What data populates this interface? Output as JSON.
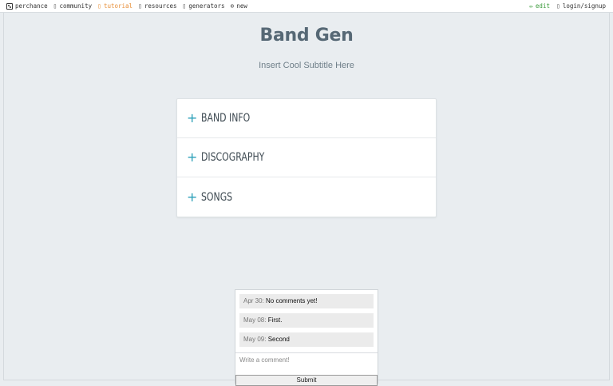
{
  "nav": {
    "left": [
      {
        "icon": "dice-icon",
        "label": "perchance"
      },
      {
        "icon": "community-icon",
        "label": "community"
      },
      {
        "icon": "tutorial-icon",
        "label": "tutorial"
      },
      {
        "icon": "resources-icon",
        "label": "resources"
      },
      {
        "icon": "generators-icon",
        "label": "generators"
      },
      {
        "icon": "new-plus-icon",
        "label": "new"
      }
    ],
    "right": [
      {
        "icon": "pencil-icon",
        "label": "edit"
      },
      {
        "icon": "user-icon",
        "label": "login/signup"
      }
    ]
  },
  "header": {
    "title": "Band Gen",
    "subtitle": "Insert Cool Subtitle Here"
  },
  "accordion": {
    "items": [
      {
        "label": "BAND INFO"
      },
      {
        "label": "DISCOGRAPHY"
      },
      {
        "label": "SONGS"
      }
    ]
  },
  "comments": {
    "items": [
      {
        "date": "Apr 30:",
        "text": "No comments yet!"
      },
      {
        "date": "May 08:",
        "text": "First."
      },
      {
        "date": "May 09:",
        "text": "Second"
      }
    ],
    "placeholder": "Write a comment!",
    "submit_label": "Submit"
  },
  "colors": {
    "accent": "#2a9fb8",
    "tutorial": "#e8903a",
    "edit": "#3a9a3a",
    "title": "#566875",
    "background": "#e9edf0"
  }
}
